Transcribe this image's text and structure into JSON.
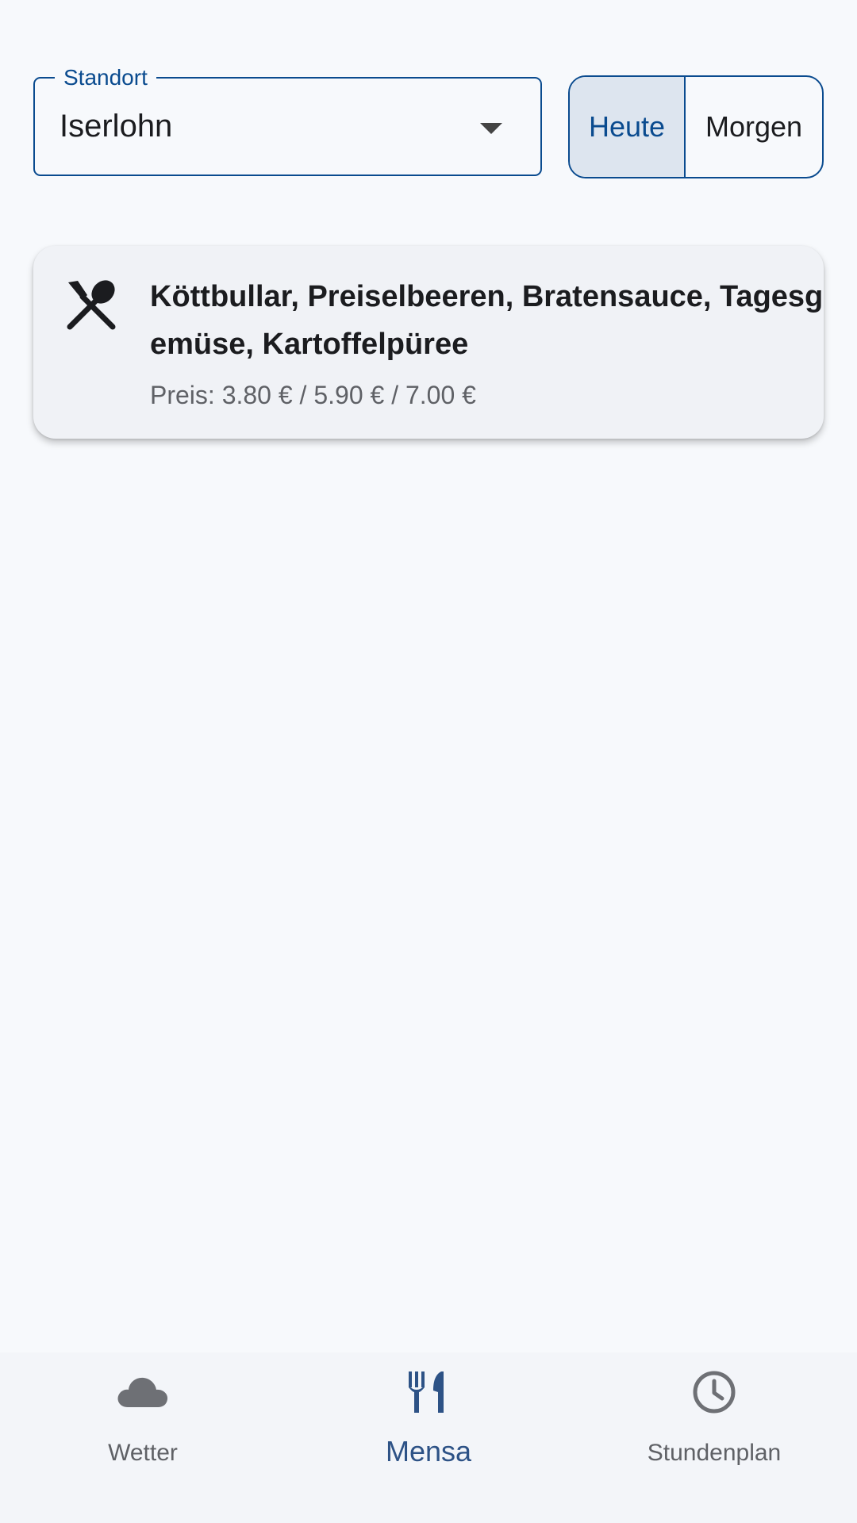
{
  "location": {
    "label": "Standort",
    "value": "Iserlohn"
  },
  "day_toggle": {
    "today": "Heute",
    "tomorrow": "Morgen",
    "selected": "Heute"
  },
  "meals": [
    {
      "name": "Köttbullar, Preiselbeeren, Bratensauce, Tagesgemüse, Kartoffelpüree",
      "price": "Preis: 3.80 € / 5.90 € / 7.00 €",
      "icon": "cutlery-icon"
    }
  ],
  "nav": {
    "items": [
      {
        "label": "Wetter",
        "icon": "cloud-icon"
      },
      {
        "label": "Mensa",
        "icon": "restaurant-icon",
        "active": true
      },
      {
        "label": "Stundenplan",
        "icon": "clock-icon"
      }
    ]
  },
  "colors": {
    "accent": "#0a4b8f",
    "nav_active": "#2d5286",
    "background": "#f7f9fc"
  }
}
